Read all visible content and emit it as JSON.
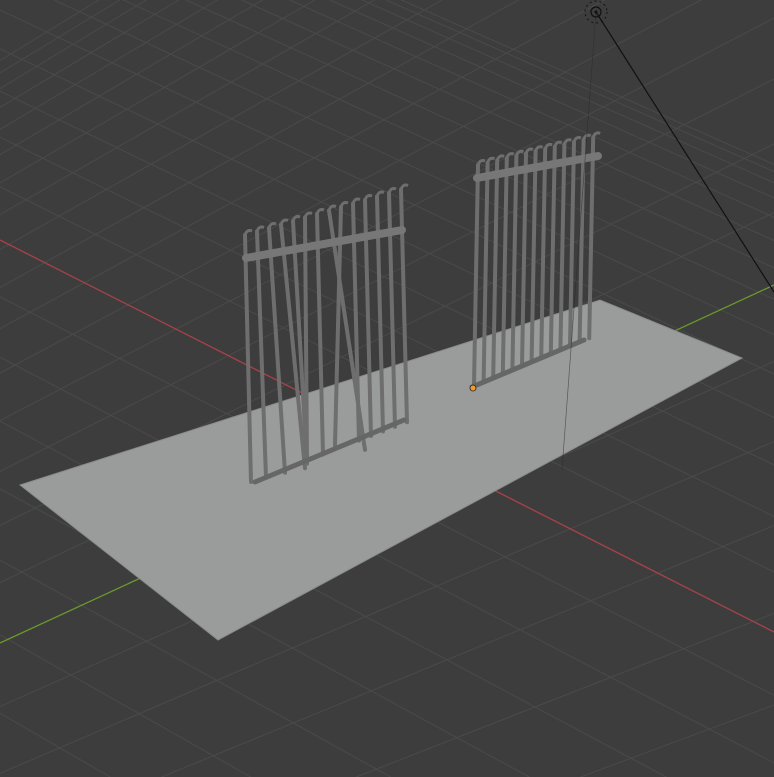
{
  "viewport": {
    "background": "#3d3d3d",
    "grid_color": "#4a4a4a",
    "x_axis_color": "#a8414a",
    "y_axis_color": "#6a9a2c",
    "plane_color": "#9a9b9b",
    "gate_color": "#6e6e6e",
    "origin_color": "#f29a2e"
  },
  "objects": [
    "ground-plane",
    "gate-left-bent",
    "gate-right",
    "light",
    "origin-point"
  ],
  "icons": [
    "light-icon"
  ]
}
